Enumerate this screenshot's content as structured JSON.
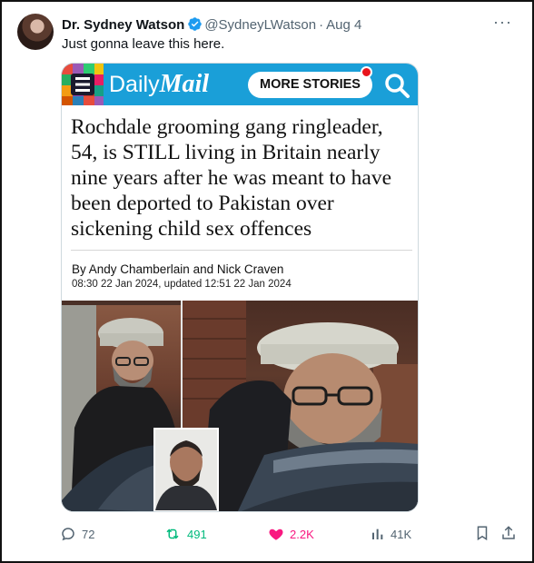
{
  "tweet": {
    "author_name": "Dr. Sydney Watson",
    "handle": "@SydneyLWatson",
    "separator": "·",
    "date": "Aug 4",
    "text": "Just gonna leave this here.",
    "more_icon": "more-horizontal-icon"
  },
  "article": {
    "brand_daily": "Daily",
    "brand_mail": "Mail",
    "more_stories": "MORE STORIES",
    "headline": "Rochdale grooming gang ringleader, 54, is STILL living in Britain nearly nine years after he was meant to have been deported to Pakistan over sickening child sex offences",
    "byline": "By Andy Chamberlain and Nick Craven",
    "dateline": "08:30 22 Jan 2024, updated 12:51 22 Jan 2024",
    "brand_color": "#1a9fd8"
  },
  "actions": {
    "replies": "72",
    "retweets": "491",
    "likes": "2.2K",
    "views": "41K",
    "retweet_color": "#00ba7c",
    "like_color": "#f91880"
  }
}
